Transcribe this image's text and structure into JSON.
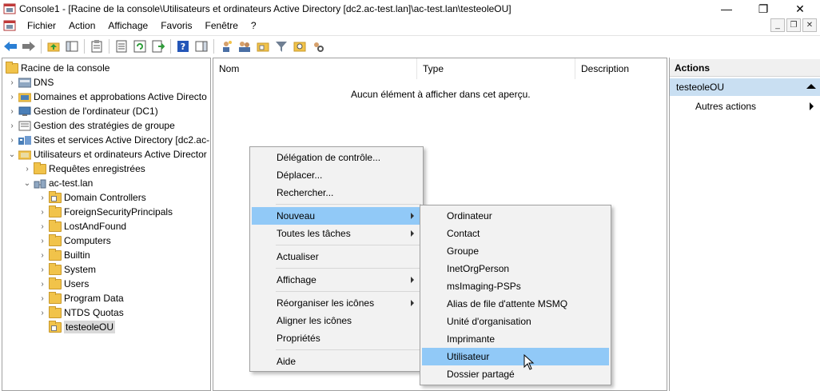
{
  "window": {
    "title": "Console1 - [Racine de la console\\Utilisateurs et ordinateurs Active Directory [dc2.ac-test.lan]\\ac-test.lan\\testeoleOU]",
    "minimize": "—",
    "restore": "❐",
    "close": "✕"
  },
  "menu": {
    "items": [
      "Fichier",
      "Action",
      "Affichage",
      "Favoris",
      "Fenêtre",
      "?"
    ]
  },
  "tree": {
    "root": "Racine de la console",
    "items": [
      "DNS",
      "Domaines et approbations Active Directo",
      "Gestion de l'ordinateur (DC1)",
      "Gestion des stratégies de groupe",
      "Sites et services Active Directory [dc2.ac-",
      "Utilisateurs et ordinateurs Active Director",
      "Requêtes enregistrées",
      "ac-test.lan",
      "Domain Controllers",
      "ForeignSecurityPrincipals",
      "LostAndFound",
      "Computers",
      "Builtin",
      "System",
      "Users",
      "Program Data",
      "NTDS Quotas",
      "testeoleOU"
    ]
  },
  "list": {
    "columns": [
      "Nom",
      "Type",
      "Description"
    ],
    "empty_message": "Aucun élément à afficher dans cet aperçu."
  },
  "actions": {
    "header": "Actions",
    "selected": "testeoleOU",
    "more": "Autres actions"
  },
  "context_menu": {
    "items": [
      "Délégation de contrôle...",
      "Déplacer...",
      "Rechercher...",
      "Nouveau",
      "Toutes les tâches",
      "Actualiser",
      "Affichage",
      "Réorganiser les icônes",
      "Aligner les icônes",
      "Propriétés",
      "Aide"
    ]
  },
  "submenu": {
    "items": [
      "Ordinateur",
      "Contact",
      "Groupe",
      "InetOrgPerson",
      "msImaging-PSPs",
      "Alias de file d'attente MSMQ",
      "Unité d'organisation",
      "Imprimante",
      "Utilisateur",
      "Dossier partagé"
    ]
  },
  "colors": {
    "highlight": "#91c9f7",
    "actions_selected": "#c9dff2",
    "folder": "#f1c34a"
  }
}
